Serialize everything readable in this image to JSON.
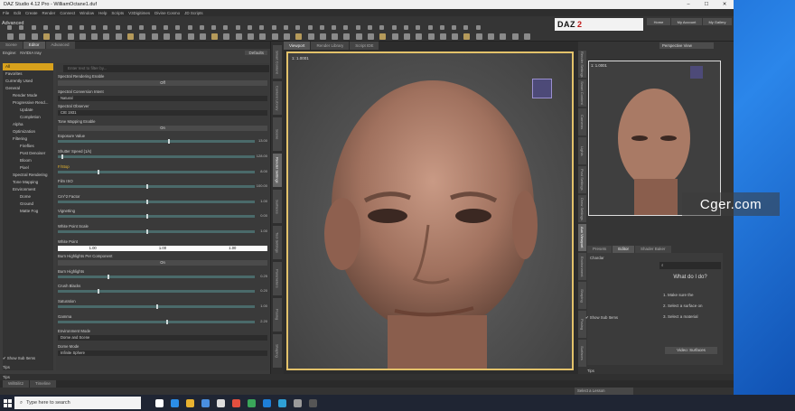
{
  "window": {
    "title": "DAZ Studio 4.12 Pro - WilliamOctane1.duf"
  },
  "menu": [
    "File",
    "Edit",
    "Create",
    "Render",
    "Connect",
    "Window",
    "Help",
    "Scripts",
    "V3Digitimes",
    "Divine Cosmo",
    "JD Scripts"
  ],
  "toolbar": {
    "tab": "Advanced",
    "logo_left": "DAZ",
    "logo_right": "2"
  },
  "header_buttons": [
    "Home",
    "My Account",
    "My Gallery"
  ],
  "left_panel": {
    "tabs": [
      "Scene",
      "Editor",
      "Advanced"
    ],
    "engine_label": "Engine:",
    "engine_value": "NVIDIA Iray",
    "defaults_button": "Defaults",
    "categories": [
      {
        "label": "All",
        "depth": 0,
        "selected": true
      },
      {
        "label": "Favorites",
        "depth": 0
      },
      {
        "label": "Currently Used",
        "depth": 0
      },
      {
        "label": "General",
        "depth": 0
      },
      {
        "label": "Render Mode",
        "depth": 1
      },
      {
        "label": "Progressive Rend...",
        "depth": 1
      },
      {
        "label": "Update",
        "depth": 2
      },
      {
        "label": "Completion",
        "depth": 2
      },
      {
        "label": "Alpha",
        "depth": 1
      },
      {
        "label": "Optimization",
        "depth": 1
      },
      {
        "label": "Filtering",
        "depth": 1
      },
      {
        "label": "Fireflies",
        "depth": 2
      },
      {
        "label": "Post Denoiser",
        "depth": 2
      },
      {
        "label": "Bloom",
        "depth": 2
      },
      {
        "label": "Pixel",
        "depth": 2
      },
      {
        "label": "Spectral Rendering",
        "depth": 1
      },
      {
        "label": "Tone Mapping",
        "depth": 1
      },
      {
        "label": "Environment",
        "depth": 1
      },
      {
        "label": "Dome",
        "depth": 2
      },
      {
        "label": "Ground",
        "depth": 2
      },
      {
        "label": "Matte Fog",
        "depth": 2
      }
    ],
    "search_placeholder": "Enter text to filter by...",
    "properties": [
      {
        "label": "Spectral Rendering Enable",
        "kind": "toggle",
        "value": "Off"
      },
      {
        "label": "Spectral Conversion Intent",
        "kind": "dropdown",
        "value": "Natural"
      },
      {
        "label": "Spectral Observer",
        "kind": "dropdown",
        "value": "CIE 1931"
      },
      {
        "label": "Tone Mapping Enable",
        "kind": "toggle",
        "value": "On"
      },
      {
        "label": "Exposure Value",
        "kind": "slider",
        "value": "13.00",
        "pos": 0.56
      },
      {
        "label": "Shutter Speed (1/s)",
        "kind": "slider",
        "value": "128.00",
        "pos": 0.02
      },
      {
        "label": "F/Stop",
        "kind": "slider",
        "value": "8.00",
        "pos": 0.2,
        "highlight": true
      },
      {
        "label": "Film ISO",
        "kind": "slider",
        "value": "100.00",
        "pos": 0.45
      },
      {
        "label": "Cm^2 Factor",
        "kind": "slider",
        "value": "1.00",
        "pos": 0.45
      },
      {
        "label": "Vignetting",
        "kind": "slider",
        "value": "0.00",
        "pos": 0.45
      },
      {
        "label": "White Point Scale",
        "kind": "slider",
        "value": "1.00",
        "pos": 0.45
      },
      {
        "label": "White Point",
        "kind": "color",
        "value": [
          "1.00",
          "1.00",
          "1.00"
        ]
      },
      {
        "label": "Burn Highlights Per Component",
        "kind": "toggle",
        "value": "On"
      },
      {
        "label": "Burn Highlights",
        "kind": "slider",
        "value": "0.25",
        "pos": 0.25
      },
      {
        "label": "Crush Blacks",
        "kind": "slider",
        "value": "0.20",
        "pos": 0.2
      },
      {
        "label": "Saturation",
        "kind": "slider",
        "value": "1.00",
        "pos": 0.5
      },
      {
        "label": "Gamma",
        "kind": "slider",
        "value": "2.20",
        "pos": 0.55
      },
      {
        "label": "Environment Mode",
        "kind": "dropdown",
        "value": "Dome and Scene"
      },
      {
        "label": "Dome Mode",
        "kind": "dropdown",
        "value": "Infinite Sphere"
      }
    ],
    "show_sub_items": "Show Sub Items",
    "tips": "Tips"
  },
  "left_vtabs": [
    "Smart Content",
    "Content Library",
    "Scene",
    "Render Settings",
    "Surfaces",
    "Tool Settings",
    "Parameters",
    "Posing",
    "Shaping"
  ],
  "viewport": {
    "tabs": [
      "Viewport",
      "Render Library",
      "Script IDE"
    ],
    "zoom": "1: 1.0001"
  },
  "right_panel": {
    "view": "Perspective View",
    "aux_zoom": "1: 1.0001",
    "tabs": [
      "Presets",
      "Editor",
      "Shader Baker"
    ],
    "surface_label": "Chardar",
    "what_title": "What do I do?",
    "steps": [
      "1. Make sure the",
      "2. Select a surface on",
      "3. Select a material"
    ],
    "video_button": "Video: Surfaces",
    "show_sub_items": "Show Sub Items",
    "tips": "Tips"
  },
  "right_vtabs": [
    "Render Settings",
    "Smart Content",
    "Cameras",
    "Lights",
    "Post Settings",
    "Draw Settings",
    "Aux Viewport",
    "Environment",
    "Shaping",
    "Posing",
    "Surfaces"
  ],
  "bottom_tabs": [
    "WillBilit2",
    "Timeline"
  ],
  "lesson": "Select a Lesson",
  "taskbar": {
    "search_placeholder": "Type here to search"
  },
  "watermark": "Cger.com",
  "colors": {
    "accent": "#d8a11c",
    "viewport_border": "#e3c26a"
  }
}
